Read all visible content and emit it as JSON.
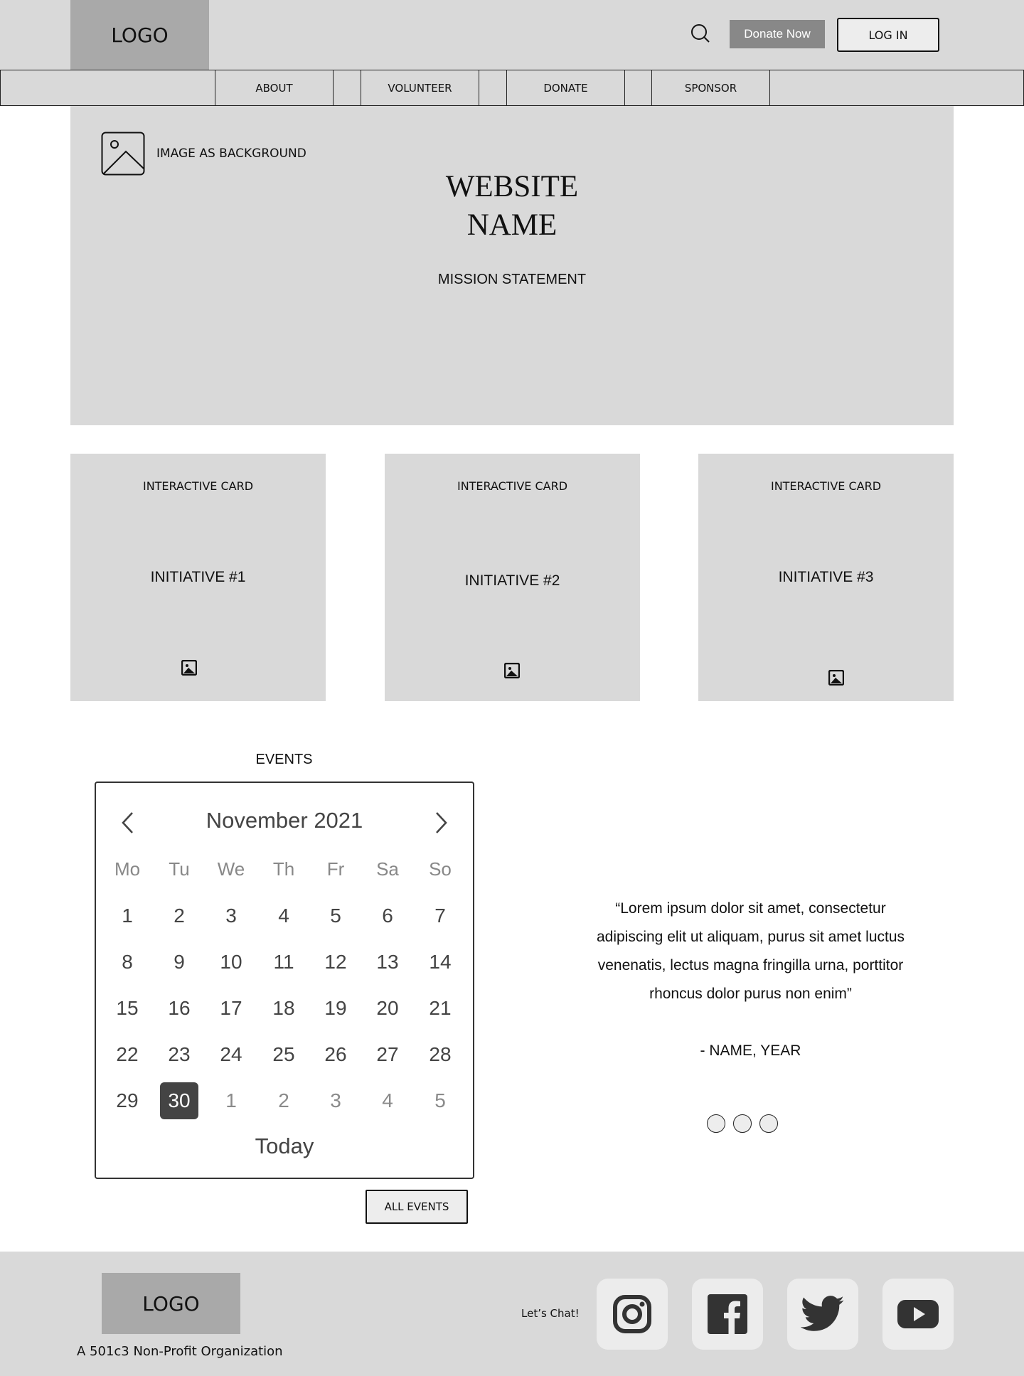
{
  "header": {
    "logo": "LOGO",
    "donate_now": "Donate Now",
    "login": "LOG IN"
  },
  "nav": {
    "items": [
      "ABOUT",
      "VOLUNTEER",
      "DONATE",
      "SPONSOR"
    ]
  },
  "hero": {
    "image_label": "IMAGE AS BACKGROUND",
    "site_name_line1": "WEBSITE",
    "site_name_line2": "NAME",
    "mission": "MISSION STATEMENT"
  },
  "cards": [
    {
      "label": "INTERACTIVE CARD",
      "title": "INITIATIVE #1",
      "icon": "image-icon"
    },
    {
      "label": "INTERACTIVE CARD",
      "title": "INITIATIVE #2",
      "icon": "image-icon"
    },
    {
      "label": "INTERACTIVE CARD",
      "title": "INITIATIVE #3",
      "icon": "image-icon"
    }
  ],
  "events": {
    "title": "EVENTS",
    "calendar": {
      "month": "November 2021",
      "weekdays": [
        "Mo",
        "Tu",
        "We",
        "Th",
        "Fr",
        "Sa",
        "So"
      ],
      "weeks": [
        [
          "1",
          "2",
          "3",
          "4",
          "5",
          "6",
          "7"
        ],
        [
          "8",
          "9",
          "10",
          "11",
          "12",
          "13",
          "14"
        ],
        [
          "15",
          "16",
          "17",
          "18",
          "19",
          "20",
          "21"
        ],
        [
          "22",
          "23",
          "24",
          "25",
          "26",
          "27",
          "28"
        ],
        [
          "29",
          "30",
          "1",
          "2",
          "3",
          "4",
          "5"
        ]
      ],
      "selected": "30",
      "today": "Today"
    },
    "all_events": "ALL EVENTS"
  },
  "testimonial": {
    "quote_lines": [
      "“Lorem ipsum dolor sit amet, consectetur",
      "adipiscing elit ut aliquam, purus sit amet luctus",
      "venenatis, lectus magna fringilla urna, porttitor",
      "rhoncus dolor purus non enim”"
    ],
    "author": "- NAME, YEAR",
    "dot_count": 3
  },
  "footer": {
    "logo": "LOGO",
    "tagline": "A 501c3 Non-Profit Organization",
    "lets_chat": "Let’s Chat!",
    "social": [
      "instagram-icon",
      "facebook-icon",
      "twitter-icon",
      "youtube-icon"
    ]
  },
  "colors": {
    "panel": "#d9d9d9",
    "logo_bg": "#a9a9a9",
    "donate_bg": "#888888",
    "selected_day": "#444444"
  }
}
